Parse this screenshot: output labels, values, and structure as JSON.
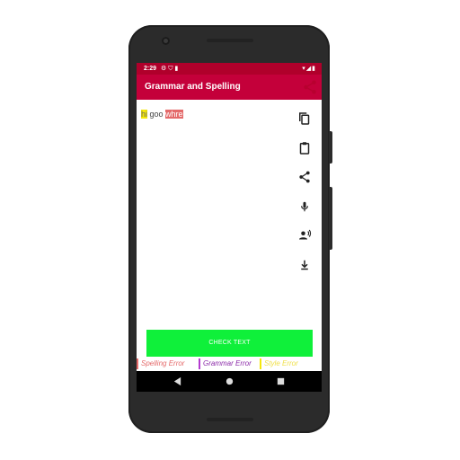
{
  "status_bar": {
    "time": "2:29",
    "left_icons": [
      "gear-icon",
      "shield-icon",
      "sd-card-icon"
    ],
    "right_icons": [
      "wifi-icon",
      "signal-icon",
      "battery-icon"
    ]
  },
  "app_bar": {
    "title": "Grammar and Spelling",
    "action_icon": "share-icon"
  },
  "editor": {
    "words": [
      {
        "text": "hi",
        "highlight": "style"
      },
      {
        "text": " goo ",
        "highlight": "none"
      },
      {
        "text": "whre",
        "highlight": "spelling"
      }
    ]
  },
  "toolbar": {
    "icons": [
      "copy-icon",
      "paste-icon",
      "share-icon",
      "mic-icon",
      "speak-icon",
      "download-icon"
    ]
  },
  "check_button": {
    "label": "CHECK TEXT"
  },
  "legend": {
    "spelling": "Spelling Error",
    "grammar": "Grammar Error",
    "style": "Style Error"
  },
  "colors": {
    "status_bar": "#b0002b",
    "app_bar": "#c4003a",
    "check_button": "#0ff03a",
    "spelling": "#e46a6a",
    "grammar": "#b33bd0",
    "style": "#f5e80a"
  },
  "nav_bar": {
    "icons": [
      "back-icon",
      "home-icon",
      "recent-apps-icon"
    ]
  }
}
